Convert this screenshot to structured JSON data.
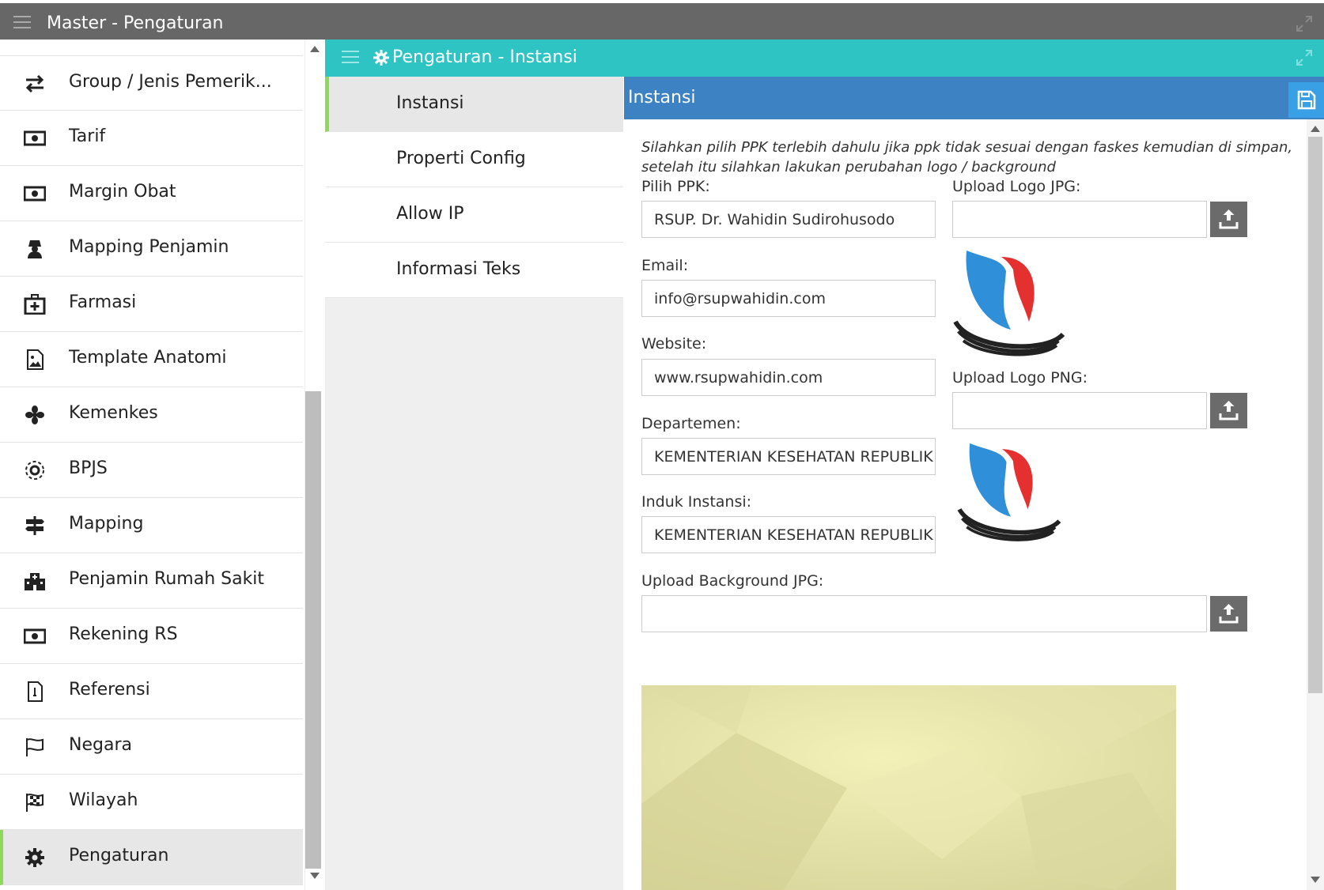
{
  "window": {
    "title": "Master - Pengaturan"
  },
  "sidebar": {
    "items": [
      {
        "label": "Group / Jenis Pemerik...",
        "icon": "arrows-exchange-icon"
      },
      {
        "label": "Tarif",
        "icon": "money-icon"
      },
      {
        "label": "Margin Obat",
        "icon": "money-icon"
      },
      {
        "label": "Mapping Penjamin",
        "icon": "user-secret-icon"
      },
      {
        "label": "Farmasi",
        "icon": "medkit-icon"
      },
      {
        "label": "Template Anatomi",
        "icon": "image-file-icon"
      },
      {
        "label": "Kemenkes",
        "icon": "fan-icon"
      },
      {
        "label": "BPJS",
        "icon": "gear-circle-icon"
      },
      {
        "label": "Mapping",
        "icon": "signpost-icon"
      },
      {
        "label": "Penjamin Rumah Sakit",
        "icon": "hospital-icon"
      },
      {
        "label": "Rekening RS",
        "icon": "money-icon"
      },
      {
        "label": "Referensi",
        "icon": "document-icon"
      },
      {
        "label": "Negara",
        "icon": "flag-icon"
      },
      {
        "label": "Wilayah",
        "icon": "checkered-flag-icon"
      },
      {
        "label": "Pengaturan",
        "icon": "gear-icon",
        "active": true
      }
    ]
  },
  "panel": {
    "title": "Pengaturan - Instansi"
  },
  "tabs": [
    {
      "label": "Instansi",
      "active": true
    },
    {
      "label": "Properti Config"
    },
    {
      "label": "Allow IP"
    },
    {
      "label": "Informasi Teks"
    }
  ],
  "form": {
    "header": "Instansi",
    "note": "Silahkan pilih PPK terlebih dahulu jika ppk tidak sesuai dengan faskes kemudian di simpan, setelah itu silahkan lakukan perubahan logo / background",
    "ppk": {
      "label": "Pilih PPK:",
      "value": "RSUP. Dr. Wahidin Sudirohusodo"
    },
    "email": {
      "label": "Email:",
      "value": "info@rsupwahidin.com"
    },
    "website": {
      "label": "Website:",
      "value": "www.rsupwahidin.com"
    },
    "departemen": {
      "label": "Departemen:",
      "value": "KEMENTERIAN KESEHATAN REPUBLIK INDONESIA"
    },
    "induk": {
      "label": "Induk Instansi:",
      "value": "KEMENTERIAN KESEHATAN REPUBLIK INDONESIA"
    },
    "logo_jpg": {
      "label": "Upload Logo JPG:",
      "value": ""
    },
    "logo_png": {
      "label": "Upload Logo PNG:",
      "value": ""
    },
    "background": {
      "label": "Upload Background JPG:",
      "value": ""
    }
  },
  "colors": {
    "topbar": "#676767",
    "panel_bar": "#2fc4c4",
    "content_header": "#3d82c2",
    "save_button": "#3aa0e6",
    "active_indicator": "#8ed85a"
  }
}
